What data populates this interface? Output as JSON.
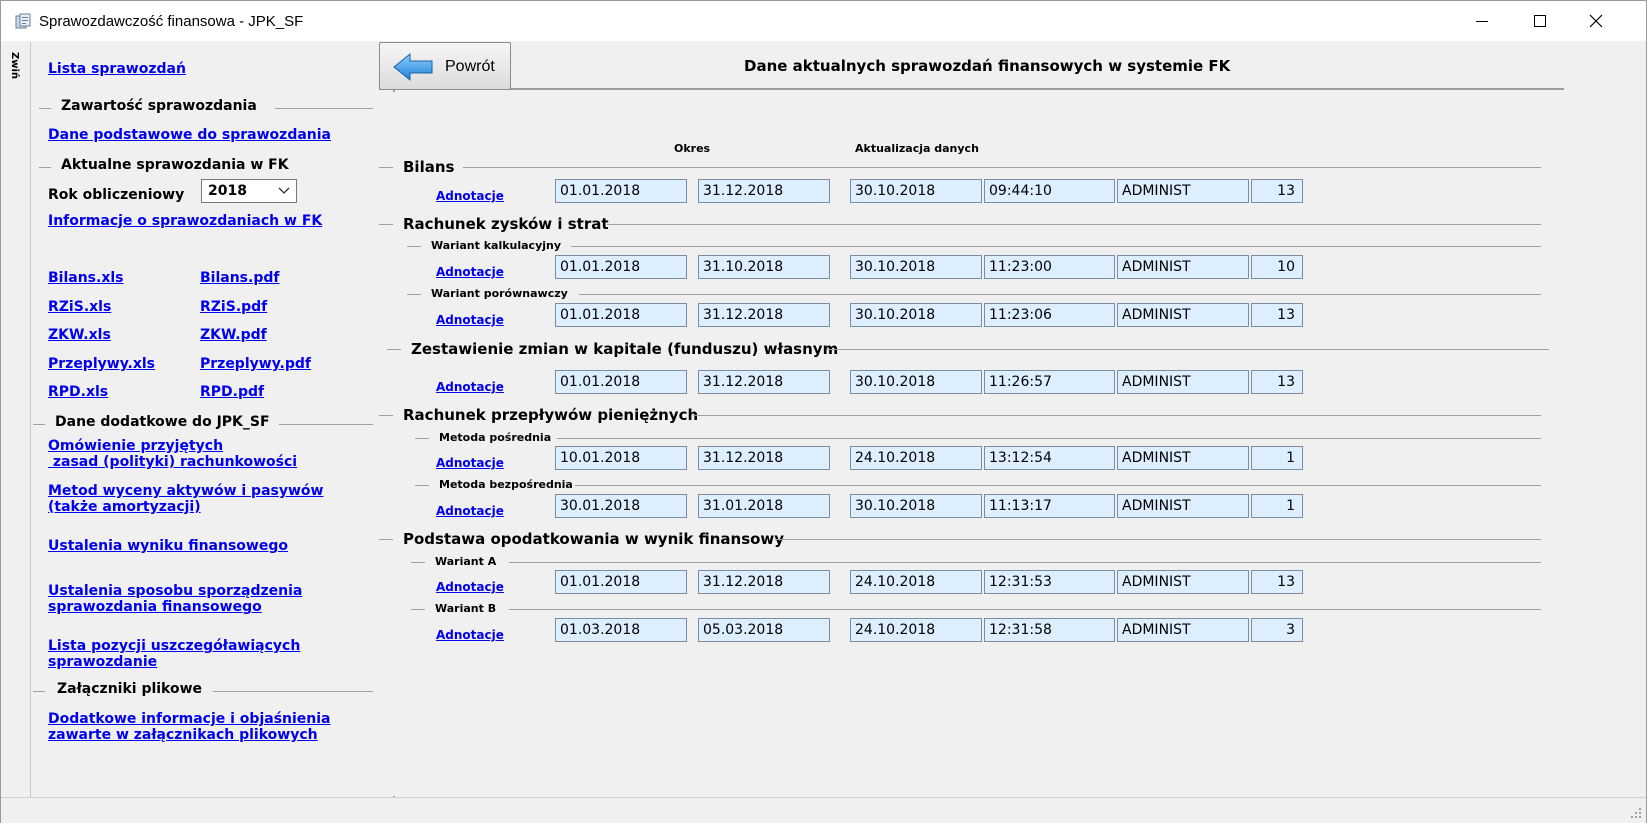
{
  "window": {
    "title": "Sprawozdawczość finansowa - JPK_SF",
    "minimize_label": "",
    "maximize_label": "",
    "close_label": ""
  },
  "rail": {
    "label": "Zwiń"
  },
  "nav": {
    "top_link": "Lista sprawozdań",
    "group_content": "Zawartość sprawozdania",
    "basic_data_link": "Dane podstawowe do sprawozdania",
    "group_current": "Aktualne sprawozdania w FK",
    "year_label": "Rok obliczeniowy",
    "year_value": "2018",
    "info_link": "Informacje o sprawozdaniach w FK",
    "files": [
      {
        "xls": "Bilans.xls",
        "pdf": "Bilans.pdf"
      },
      {
        "xls": "RZiS.xls",
        "pdf": "RZiS.pdf"
      },
      {
        "xls": "ZKW.xls",
        "pdf": "ZKW.pdf"
      },
      {
        "xls": "Przeplywy.xls",
        "pdf": "Przeplywy.pdf"
      },
      {
        "xls": "RPD.xls",
        "pdf": "RPD.pdf"
      }
    ],
    "group_extra": "Dane dodatkowe do JPK_SF",
    "extra_links": [
      "Omówienie przyjętych\n zasad (polityki) rachunkowości",
      "Metod wyceny aktywów i pasywów\n(także amortyzacji)",
      "Ustalenia wyniku finansowego",
      "Ustalenia sposobu sporządzenia\nsprawozdania finansowego",
      "Lista pozycji uszczegóławiących\nsprawozdanie"
    ],
    "group_attachments": "Załączniki plikowe",
    "attachments_link": "Dodatkowe informacje i objaśnienia\nzawarte w załącznikach plikowych"
  },
  "header": {
    "back_label": "Powrót",
    "title": "Dane aktualnych sprawozdań finansowych w systemie FK"
  },
  "columns": {
    "period": "Okres",
    "update": "Aktualizacja danych"
  },
  "adn_label": "Adnotacje",
  "sections": [
    {
      "title": "Bilans"
    },
    {
      "title": "Rachunek zysków i strat",
      "subs": [
        "Wariant kalkulacyjny",
        "Wariant porównawczy"
      ]
    },
    {
      "title": "Zestawienie zmian w kapitale (funduszu) własnym"
    },
    {
      "title": "Rachunek przepływów pieniężnych",
      "subs": [
        "Metoda pośrednia",
        "Metoda bezpośrednia"
      ]
    },
    {
      "title": "Podstawa opodatkowania w wynik finansowy",
      "subs": [
        "Wariant A",
        "Wariant B"
      ]
    }
  ],
  "rows": [
    {
      "from": "01.01.2018",
      "to": "31.12.2018",
      "date": "30.10.2018",
      "time": "09:44:10",
      "user": "ADMINIST",
      "count": "13"
    },
    {
      "from": "01.01.2018",
      "to": "31.10.2018",
      "date": "30.10.2018",
      "time": "11:23:00",
      "user": "ADMINIST",
      "count": "10"
    },
    {
      "from": "01.01.2018",
      "to": "31.12.2018",
      "date": "30.10.2018",
      "time": "11:23:06",
      "user": "ADMINIST",
      "count": "13"
    },
    {
      "from": "01.01.2018",
      "to": "31.12.2018",
      "date": "30.10.2018",
      "time": "11:26:57",
      "user": "ADMINIST",
      "count": "13"
    },
    {
      "from": "10.01.2018",
      "to": "31.12.2018",
      "date": "24.10.2018",
      "time": "13:12:54",
      "user": "ADMINIST",
      "count": "1"
    },
    {
      "from": "30.01.2018",
      "to": "31.01.2018",
      "date": "30.10.2018",
      "time": "11:13:17",
      "user": "ADMINIST",
      "count": "1"
    },
    {
      "from": "01.01.2018",
      "to": "31.12.2018",
      "date": "24.10.2018",
      "time": "12:31:53",
      "user": "ADMINIST",
      "count": "13"
    },
    {
      "from": "01.03.2018",
      "to": "05.03.2018",
      "date": "24.10.2018",
      "time": "12:31:58",
      "user": "ADMINIST",
      "count": "3"
    }
  ]
}
